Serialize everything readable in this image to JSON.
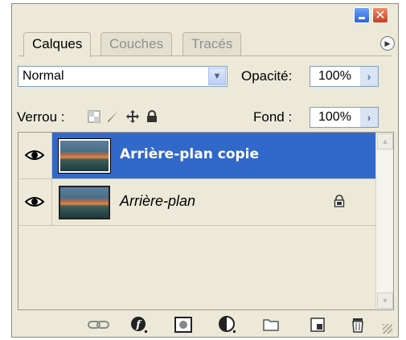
{
  "window": {
    "minimize_icon": "minimize-icon",
    "close_icon": "close-icon"
  },
  "tabs": [
    {
      "label": "Calques",
      "active": true
    },
    {
      "label": "Couches",
      "active": false
    },
    {
      "label": "Tracés",
      "active": false
    }
  ],
  "blend": {
    "mode": "Normal"
  },
  "opacity": {
    "label": "Opacité:",
    "value": "100%"
  },
  "lock": {
    "label": "Verrou :",
    "icons": [
      "transparency-lock-icon",
      "brush-lock-icon",
      "move-lock-icon",
      "padlock-icon"
    ]
  },
  "fill": {
    "label": "Fond :",
    "value": "100%"
  },
  "layers": [
    {
      "name": "Arrière-plan copie",
      "selected": true,
      "locked": false
    },
    {
      "name": "Arrière-plan",
      "selected": false,
      "locked": true
    }
  ],
  "toolbar": {
    "icons": [
      "link-icon",
      "layer-style-icon",
      "mask-icon",
      "adjustment-icon",
      "group-folder-icon",
      "new-layer-icon",
      "trash-icon"
    ]
  },
  "colors": {
    "selection": "#3168c9",
    "panel_bg": "#ece9d8"
  }
}
